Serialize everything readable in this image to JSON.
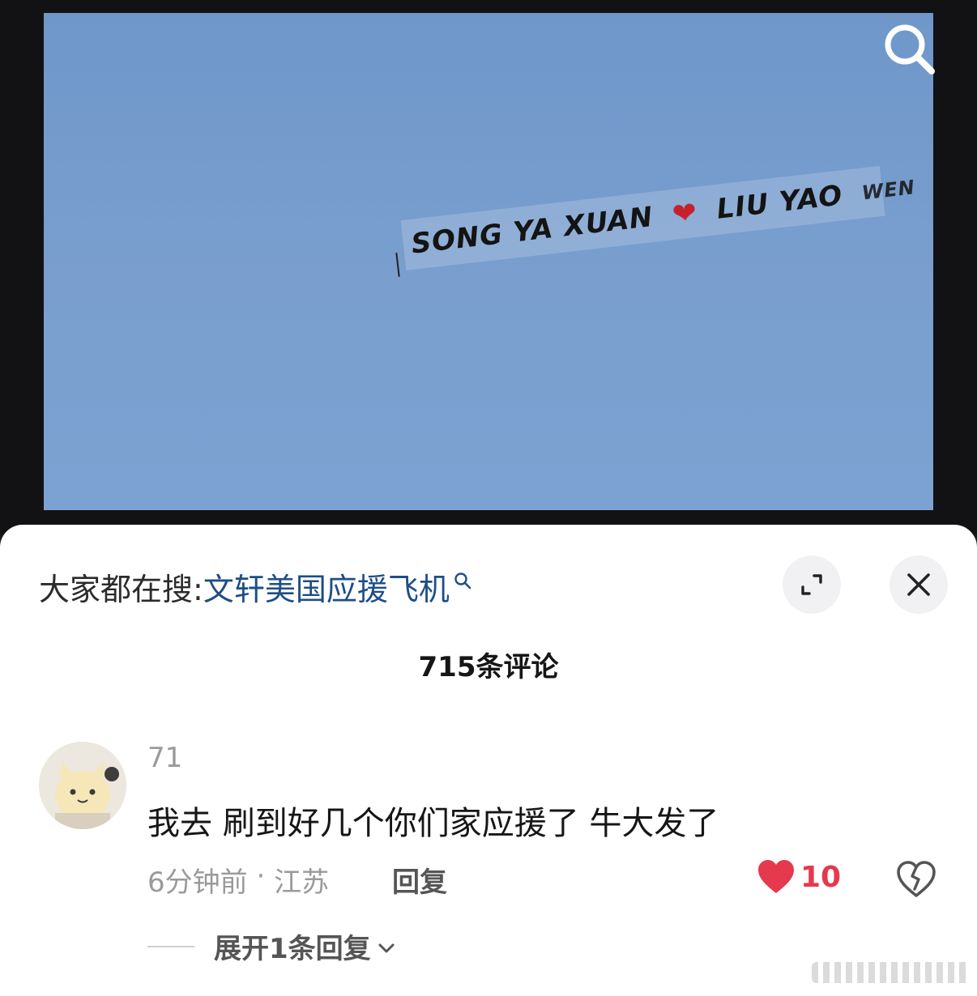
{
  "video": {
    "banner_part1": "SONG YA XUAN",
    "banner_heart": "❤",
    "banner_part2": "LIU YAO",
    "banner_part3": "WEN"
  },
  "search_suggestion": {
    "label": "大家都在搜:",
    "query": "文轩美国应援飞机"
  },
  "comments_header": {
    "count_text": "715条评论"
  },
  "comment": {
    "username": "71",
    "text": "我去 刷到好几个你们家应援了 牛大发了",
    "time": "6分钟前",
    "separator": " · ",
    "location": "江苏",
    "reply_label": "回复",
    "like_count": "10",
    "expand_label": "展开1条回复"
  },
  "colors": {
    "accent_link": "#1e4e86",
    "like_red": "#e5394e"
  }
}
